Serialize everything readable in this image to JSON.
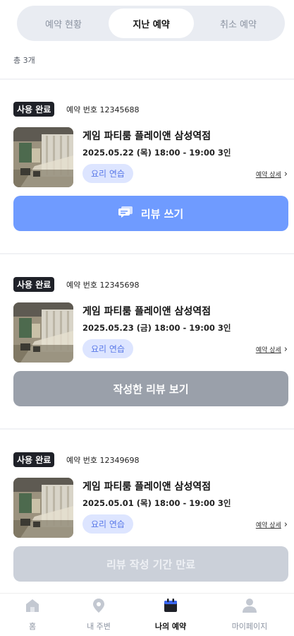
{
  "tabs": [
    {
      "label": "예약 현황"
    },
    {
      "label": "지난 예약",
      "active": true
    },
    {
      "label": "취소 예약"
    }
  ],
  "total": "총 3개",
  "reservations": [
    {
      "status": "사용 완료",
      "number": "예약 번호 12345688",
      "title": "게임 파티룸 플레이앤 삼성역점",
      "datetime": "2025.05.22 (목) 18:00 - 19:00 3인",
      "tag": "요리 연습",
      "detail": "예약 상세",
      "action": "리뷰 쓰기",
      "action_icon": "review-icon"
    },
    {
      "status": "사용 완료",
      "number": "예약 번호 12345698",
      "title": "게임 파티룸 플레이앤 삼성역점",
      "datetime": "2025.05.23 (금) 18:00 - 19:00 3인",
      "tag": "요리 연습",
      "detail": "예약 상세",
      "action": "작성한 리뷰 보기"
    },
    {
      "status": "사용 완료",
      "number": "예약 번호 12349698",
      "title": "게임 파티룸 플레이앤 삼성역점",
      "datetime": "2025.05.01 (목) 18:00 - 19:00 3인",
      "tag": "요리 연습",
      "detail": "예약 상세",
      "action": "리뷰 작성 기간 만료"
    }
  ],
  "nav": [
    {
      "label": "홈",
      "icon": "home-icon"
    },
    {
      "label": "내 주변",
      "icon": "location-pin-icon"
    },
    {
      "label": "나의 예약",
      "icon": "calendar-icon",
      "active": true
    },
    {
      "label": "마이페이지",
      "icon": "person-icon"
    }
  ],
  "colors": {
    "accent": "#6f9bff",
    "tag_bg": "#dde5ff",
    "tag_text": "#5a79e8",
    "badge_bg": "#1f2128",
    "button_gray": "#9aa0aa",
    "button_disabled": "#cbd0d9"
  }
}
